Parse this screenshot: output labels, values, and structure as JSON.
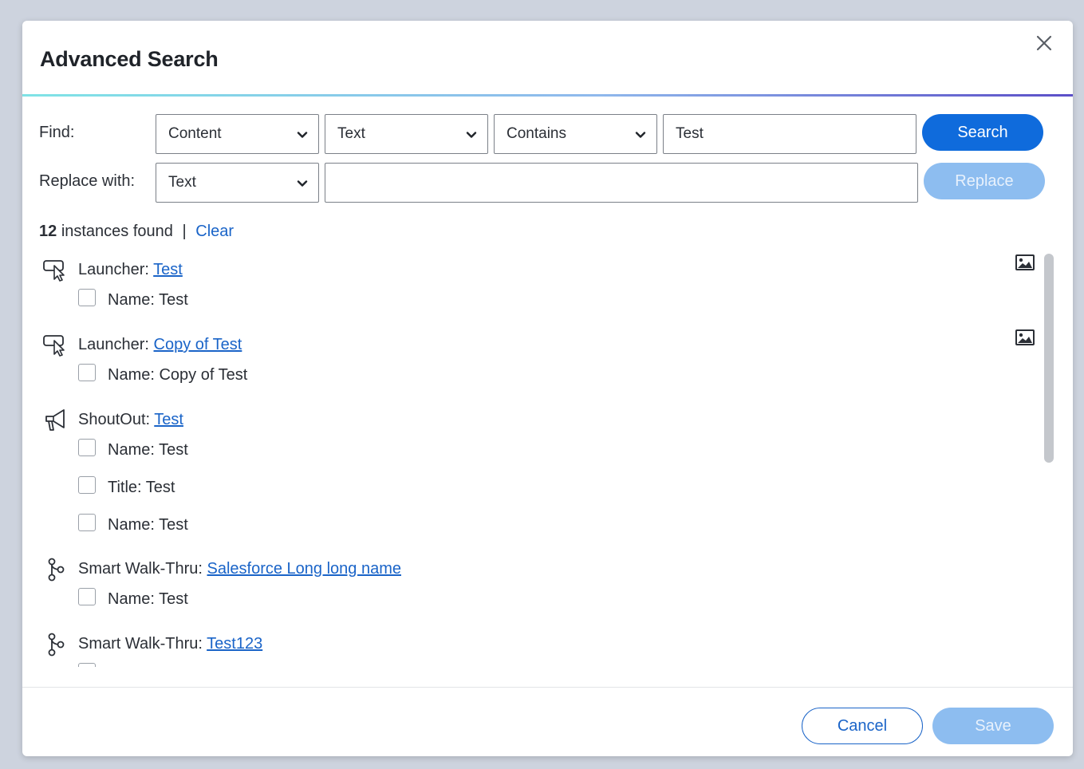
{
  "dialog": {
    "title": "Advanced Search"
  },
  "find": {
    "label": "Find:",
    "scope_value": "Content",
    "field_value": "Text",
    "operator_value": "Contains",
    "query_value": "Test",
    "search_label": "Search"
  },
  "replace": {
    "label": "Replace with:",
    "field_value": "Text",
    "replace_value": "",
    "replace_label": "Replace"
  },
  "summary": {
    "count": "12",
    "text": "instances found",
    "separator": "|",
    "clear_label": "Clear"
  },
  "results": [
    {
      "type_label": "Launcher:",
      "name": "Test",
      "icon": "launcher-icon",
      "has_image": true,
      "fields": [
        "Name: Test"
      ]
    },
    {
      "type_label": "Launcher:",
      "name": "Copy of Test",
      "icon": "launcher-icon",
      "has_image": true,
      "fields": [
        "Name: Copy of Test"
      ]
    },
    {
      "type_label": "ShoutOut:",
      "name": "Test",
      "icon": "megaphone-icon",
      "has_image": false,
      "fields": [
        "Name: Test",
        "Title: Test",
        "Name: Test"
      ]
    },
    {
      "type_label": "Smart Walk-Thru:",
      "name": "Salesforce Long long name",
      "icon": "walkthru-icon",
      "has_image": false,
      "fields": [
        "Name: Test"
      ]
    },
    {
      "type_label": "Smart Walk-Thru:",
      "name": "Test123",
      "icon": "walkthru-icon",
      "has_image": false,
      "fields": [
        ""
      ]
    }
  ],
  "footer": {
    "cancel_label": "Cancel",
    "save_label": "Save"
  },
  "colors": {
    "primary": "#0f6bdc",
    "primary_disabled": "#8dbdf0",
    "link": "#1a64c8"
  }
}
